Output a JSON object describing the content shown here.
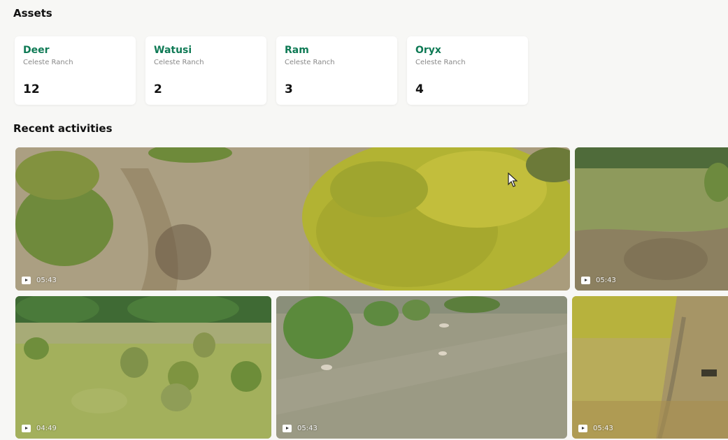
{
  "assets": {
    "title": "Assets",
    "cards": [
      {
        "name": "Deer",
        "location": "Celeste Ranch",
        "count": "12"
      },
      {
        "name": "Watusi",
        "location": "Celeste Ranch",
        "count": "2"
      },
      {
        "name": "Ram",
        "location": "Celeste Ranch",
        "count": "3"
      },
      {
        "name": "Oryx",
        "location": "Celeste Ranch",
        "count": "4"
      }
    ]
  },
  "activities": {
    "title": "Recent activities",
    "videos": [
      {
        "duration": "05:43"
      },
      {
        "duration": "05:43"
      },
      {
        "duration": "04:49"
      },
      {
        "duration": "05:43"
      },
      {
        "duration": "05:43"
      }
    ]
  },
  "colors": {
    "accent": "#0f7a55",
    "background": "#f7f7f5"
  }
}
